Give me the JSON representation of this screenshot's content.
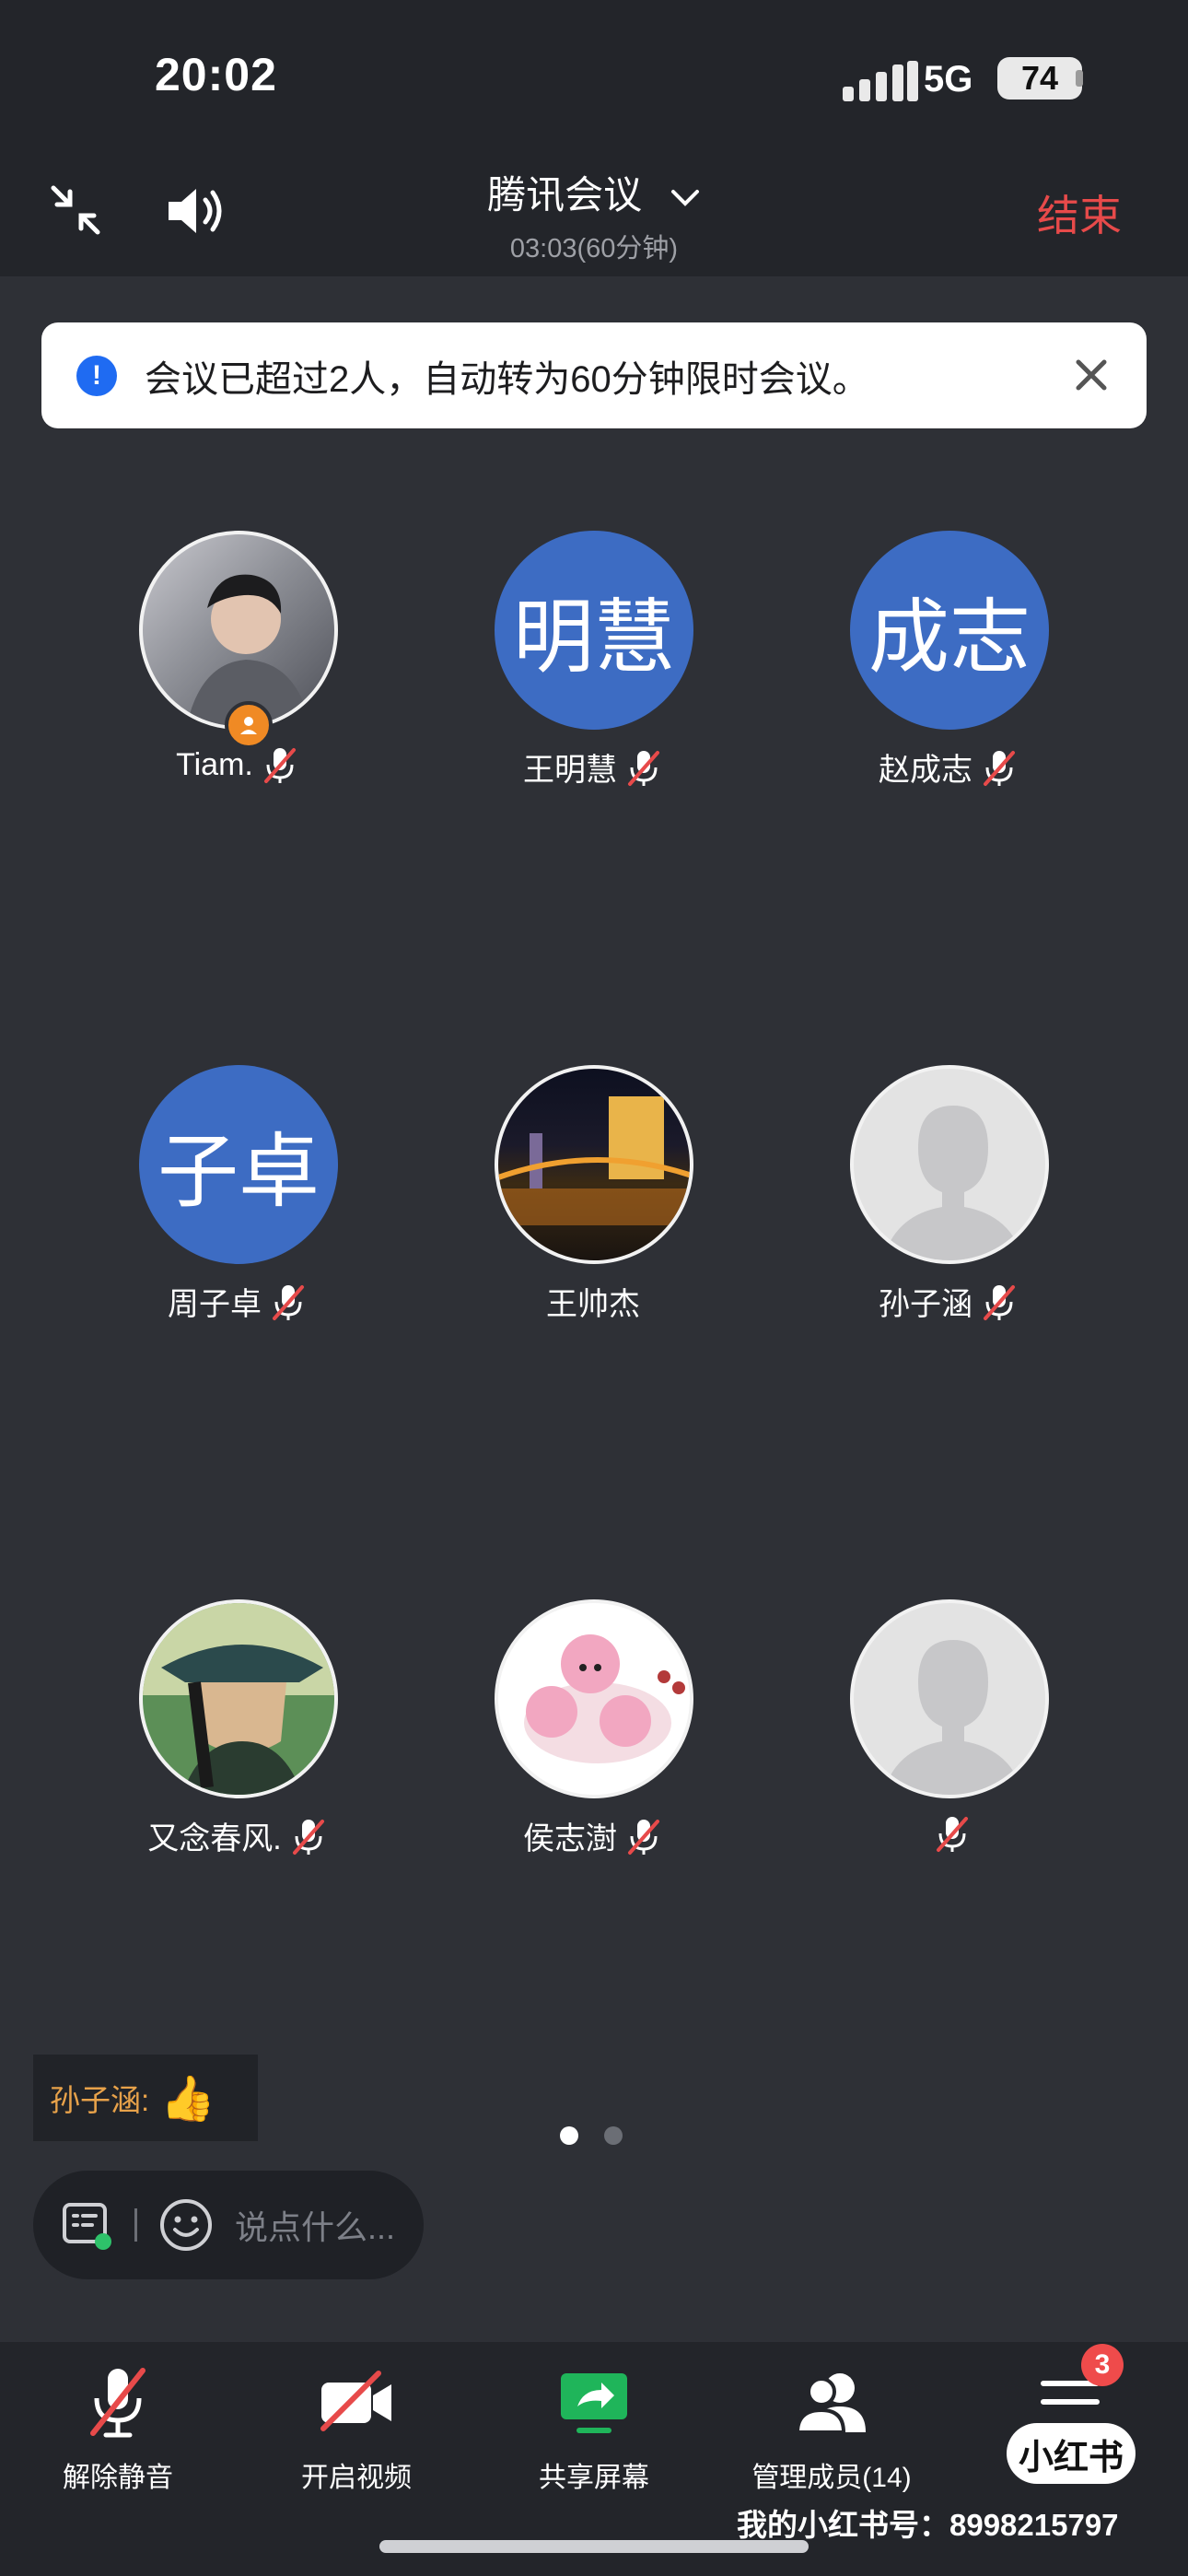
{
  "status_bar": {
    "time": "20:02",
    "network": "5G",
    "battery": "74"
  },
  "header": {
    "title": "腾讯会议",
    "duration": "03:03(60分钟)",
    "end_label": "结束"
  },
  "banner": {
    "message": "会议已超过2人，自动转为60分钟限时会议。"
  },
  "participants": [
    {
      "name": "Tiam.",
      "avatar_type": "photo",
      "avatar_text": "",
      "muted": true,
      "host": true
    },
    {
      "name": "王明慧",
      "avatar_type": "initials",
      "avatar_text": "明慧",
      "muted": true,
      "host": false
    },
    {
      "name": "赵成志",
      "avatar_type": "initials",
      "avatar_text": "成志",
      "muted": true,
      "host": false
    },
    {
      "name": "周子卓",
      "avatar_type": "initials",
      "avatar_text": "子卓",
      "muted": true,
      "host": false
    },
    {
      "name": "王帅杰",
      "avatar_type": "photo",
      "avatar_text": "",
      "muted": false,
      "host": false
    },
    {
      "name": "孙子涵",
      "avatar_type": "default",
      "avatar_text": "",
      "muted": true,
      "host": false
    },
    {
      "name": "又念春风.",
      "avatar_type": "photo",
      "avatar_text": "",
      "muted": true,
      "host": false
    },
    {
      "name": "侯志澍",
      "avatar_type": "photo",
      "avatar_text": "",
      "muted": true,
      "host": false
    },
    {
      "name": "",
      "avatar_type": "default",
      "avatar_text": "",
      "muted": true,
      "host": false
    }
  ],
  "chat": {
    "sender": "孙子涵:",
    "message": "👍"
  },
  "pagination": {
    "current": 1,
    "total": 2
  },
  "input": {
    "placeholder": "说点什么..."
  },
  "toolbar": {
    "unmute_label": "解除静音",
    "video_label": "开启视频",
    "share_label": "共享屏幕",
    "members_label": "管理成员(14)",
    "more_badge": "3"
  },
  "watermark": {
    "logo": "小红书",
    "account": "我的小红书号：8998215797"
  },
  "colors": {
    "accent_blue": "#3d6cc3",
    "end_red": "#e74a4a",
    "share_green": "#1fb55a",
    "background": "#2e3036"
  }
}
